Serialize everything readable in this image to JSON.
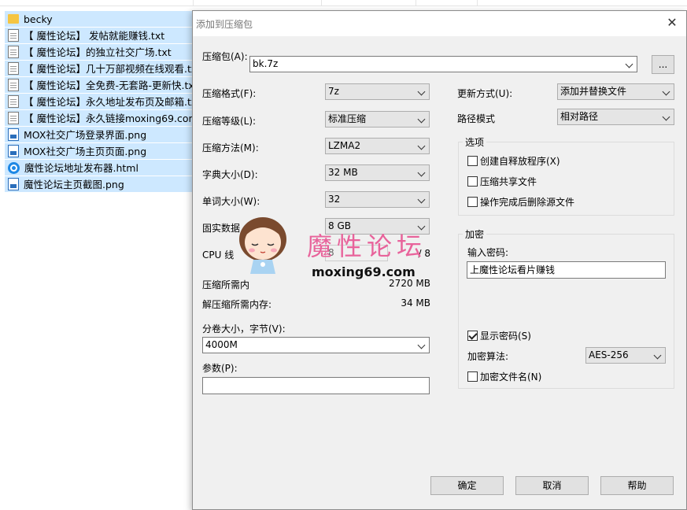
{
  "explorer": {
    "files": [
      {
        "name": "becky",
        "icon": "folder-icon",
        "type": "folder"
      },
      {
        "name": "【 魔性论坛】 发帖就能赚钱.txt",
        "icon": "text-file-icon",
        "type": "txt"
      },
      {
        "name": "【 魔性论坛】的独立社交广场.txt",
        "icon": "text-file-icon",
        "type": "txt"
      },
      {
        "name": "【 魔性论坛】几十万部视频在线观看.txt",
        "icon": "text-file-icon",
        "type": "txt"
      },
      {
        "name": "【 魔性论坛】全免费-无套路-更新快.txt",
        "icon": "text-file-icon",
        "type": "txt"
      },
      {
        "name": "【 魔性论坛】永久地址发布页及邮箱.txt",
        "icon": "text-file-icon",
        "type": "txt"
      },
      {
        "name": "【 魔性论坛】永久链接moxing69.com.t",
        "icon": "text-file-icon",
        "type": "txt"
      },
      {
        "name": "MOX社交广场登录界面.png",
        "icon": "image-file-icon",
        "type": "png"
      },
      {
        "name": "MOX社交广场主页页面.png",
        "icon": "image-file-icon",
        "type": "png"
      },
      {
        "name": "魔性论坛地址发布器.html",
        "icon": "browser-file-icon",
        "type": "html"
      },
      {
        "name": "魔性论坛主页截图.png",
        "icon": "image-file-icon",
        "type": "png"
      }
    ]
  },
  "dialog": {
    "title": "添加到压缩包",
    "archive_label": "压缩包(A):",
    "archive_value": "bk.7z",
    "browse_label": "...",
    "format_label": "压缩格式(F):",
    "format_value": "7z",
    "level_label": "压缩等级(L):",
    "level_value": "标准压缩",
    "method_label": "压缩方法(M):",
    "method_value": "LZMA2",
    "dict_label": "字典大小(D):",
    "dict_value": "32 MB",
    "word_label": "单词大小(W):",
    "word_value": "32",
    "solid_label": "固实数据",
    "solid_value": "8 GB",
    "cpu_label": "CPU 线",
    "cpu_value": "8",
    "cpu_total": "/ 8",
    "mem_compress_label": "压缩所需内",
    "mem_compress_value": "2720 MB",
    "mem_decompress_label": "解压缩所需内存:",
    "mem_decompress_value": "34 MB",
    "split_label": "分卷大小，字节(V):",
    "split_value": "4000M",
    "params_label": "参数(P):",
    "params_value": "",
    "update_label": "更新方式(U):",
    "update_value": "添加并替换文件",
    "path_label": "路径模式",
    "path_value": "相对路径",
    "options_title": "选项",
    "opt_sfx": "创建自释放程序(X)",
    "opt_shared": "压缩共享文件",
    "opt_delete": "操作完成后删除源文件",
    "encrypt_title": "加密",
    "password_label": "输入密码:",
    "password_value": "上魔性论坛看片赚钱",
    "show_password": "显示密码(S)",
    "enc_method_label": "加密算法:",
    "enc_method_value": "AES-256",
    "enc_names": "加密文件名(N)",
    "ok_label": "确定",
    "cancel_label": "取消",
    "help_label": "帮助"
  },
  "watermark": {
    "brand": "魔性论坛",
    "url": "moxing69.com"
  },
  "colors": {
    "selection": "#cde8ff",
    "dialog_bg": "#f0f0f0",
    "watermark_pink": "#e8639b"
  }
}
